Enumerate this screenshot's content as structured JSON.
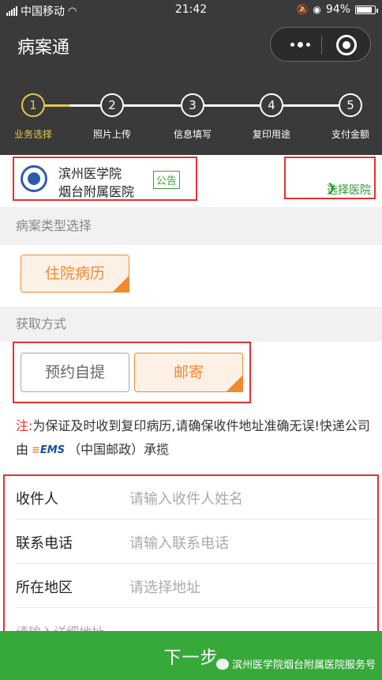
{
  "status_bar": {
    "carrier": "中国移动",
    "time": "21:42",
    "battery": "94%",
    "battery_level": 0.94
  },
  "nav": {
    "title": "病案通"
  },
  "steps": [
    {
      "num": "1",
      "label": "业务选择",
      "active": true
    },
    {
      "num": "2",
      "label": "照片上传",
      "active": false
    },
    {
      "num": "3",
      "label": "信息填写",
      "active": false
    },
    {
      "num": "4",
      "label": "复印用途",
      "active": false
    },
    {
      "num": "5",
      "label": "支付金额",
      "active": false
    }
  ],
  "hospital": {
    "name_line1": "滨州医学院",
    "name_line2": "烟台附属医院",
    "notice_label": "公告",
    "choose_label": "选择医院"
  },
  "record_type": {
    "heading": "病案类型选择",
    "options": [
      "住院病历"
    ],
    "selected": "住院病历"
  },
  "pickup": {
    "heading": "获取方式",
    "options": [
      "预约自提",
      "邮寄"
    ],
    "selected": "邮寄"
  },
  "note": {
    "prefix": "注:",
    "text": "为保证及时收到复印病历,请确保收件地址准确无误!快递公司由",
    "ems_label": "EMS",
    "suffix": "（中国邮政）承揽"
  },
  "form": {
    "recipient_label": "收件人",
    "recipient_placeholder": "请输入收件人姓名",
    "phone_label": "联系电话",
    "phone_placeholder": "请输入联系电话",
    "region_label": "所在地区",
    "region_placeholder": "请选择地址",
    "detail_placeholder": "请输入详细地址"
  },
  "bottom": {
    "next_label": "下一步",
    "watermark": "滨州医学院烟台附属医院服务号"
  },
  "colors": {
    "header_bg": "#3a3a3a",
    "active_step": "#e8c84a",
    "accent_orange": "#f08a33",
    "accent_green": "#37a93a",
    "highlight_red": "#e53030"
  }
}
